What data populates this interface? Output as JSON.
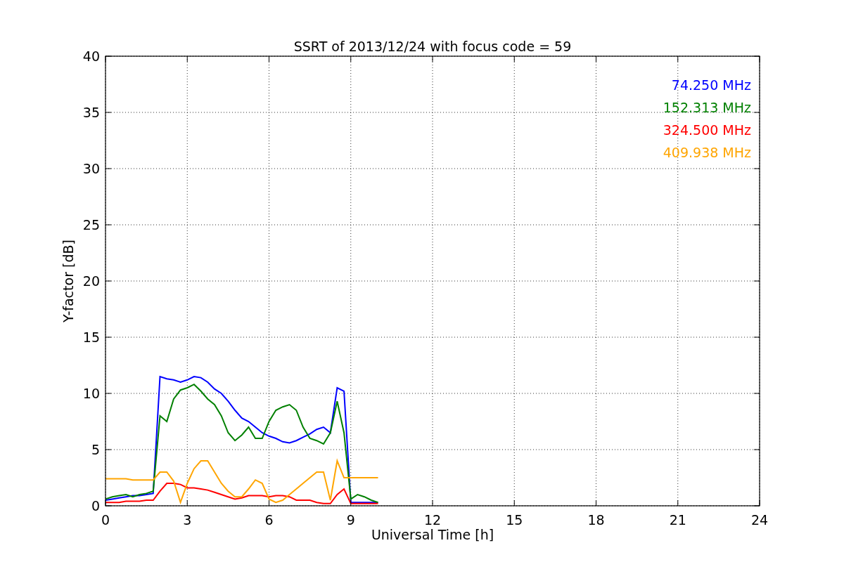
{
  "chart_data": {
    "type": "line",
    "title": "SSRT of 2013/12/24 with focus code = 59",
    "xlabel": "Universal Time [h]",
    "ylabel": "Y-factor [dB]",
    "x": [
      0,
      0.25,
      0.5,
      0.75,
      1,
      1.25,
      1.5,
      1.75,
      2,
      2.25,
      2.5,
      2.75,
      3,
      3.25,
      3.5,
      3.75,
      4,
      4.25,
      4.5,
      4.75,
      5,
      5.25,
      5.5,
      5.75,
      6,
      6.25,
      6.5,
      6.75,
      7,
      7.25,
      7.5,
      7.75,
      8,
      8.25,
      8.5,
      8.75,
      9,
      9.25,
      9.5,
      9.75,
      10
    ],
    "series": [
      {
        "name": "74.250 MHz",
        "color": "#0000ff",
        "values": [
          0.5,
          0.6,
          0.7,
          0.8,
          0.9,
          0.9,
          1.0,
          1.1,
          11.5,
          11.3,
          11.2,
          11.0,
          11.2,
          11.5,
          11.4,
          11.0,
          10.4,
          10.0,
          9.3,
          8.5,
          7.8,
          7.5,
          7.0,
          6.5,
          6.2,
          6.0,
          5.7,
          5.6,
          5.8,
          6.1,
          6.4,
          6.8,
          7.0,
          6.5,
          10.5,
          10.2,
          0.3,
          0.3,
          0.3,
          0.3,
          0.3
        ]
      },
      {
        "name": "152.313 MHz",
        "color": "#008000",
        "values": [
          0.6,
          0.8,
          0.9,
          1.0,
          0.8,
          1.0,
          1.1,
          1.3,
          8.0,
          7.5,
          9.5,
          10.3,
          10.5,
          10.8,
          10.2,
          9.5,
          9.0,
          8.0,
          6.5,
          5.8,
          6.3,
          7.0,
          6.0,
          6.0,
          7.5,
          8.5,
          8.8,
          9.0,
          8.5,
          7.0,
          6.0,
          5.8,
          5.5,
          6.5,
          9.3,
          6.5,
          0.6,
          1.0,
          0.8,
          0.5,
          0.3
        ]
      },
      {
        "name": "324.500 MHz",
        "color": "#ff0000",
        "values": [
          0.3,
          0.3,
          0.3,
          0.4,
          0.4,
          0.4,
          0.5,
          0.5,
          1.3,
          2.0,
          2.0,
          1.9,
          1.6,
          1.6,
          1.5,
          1.4,
          1.2,
          1.0,
          0.8,
          0.6,
          0.7,
          0.9,
          0.9,
          0.9,
          0.8,
          0.9,
          0.9,
          0.8,
          0.5,
          0.5,
          0.5,
          0.3,
          0.2,
          0.2,
          1.0,
          1.5,
          0.2,
          0.2,
          0.2,
          0.2,
          0.2
        ]
      },
      {
        "name": "409.938 MHz",
        "color": "#ffa500",
        "values": [
          2.4,
          2.4,
          2.4,
          2.4,
          2.3,
          2.3,
          2.3,
          2.3,
          3.0,
          3.0,
          2.2,
          0.3,
          2.0,
          3.3,
          4.0,
          4.0,
          3.0,
          2.0,
          1.3,
          0.8,
          0.8,
          1.5,
          2.3,
          2.0,
          0.6,
          0.3,
          0.5,
          1.0,
          1.5,
          2.0,
          2.5,
          3.0,
          3.0,
          0.5,
          4.0,
          2.5,
          2.5,
          2.5,
          2.5,
          2.5,
          2.5
        ]
      }
    ],
    "xlim": [
      0,
      24
    ],
    "ylim": [
      0,
      40
    ],
    "xticks": [
      0,
      3,
      6,
      9,
      12,
      15,
      18,
      21,
      24
    ],
    "yticks": [
      0,
      5,
      10,
      15,
      20,
      25,
      30,
      35,
      40
    ],
    "grid": true
  }
}
